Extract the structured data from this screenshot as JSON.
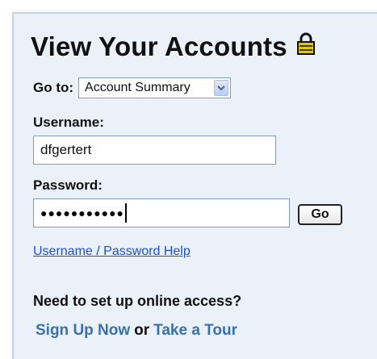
{
  "panel": {
    "title": "View Your Accounts"
  },
  "goto": {
    "label": "Go to:",
    "selected": "Account Summary"
  },
  "username": {
    "label": "Username:",
    "value": "dfgertert"
  },
  "password": {
    "label": "Password:",
    "masked_value": "●●●●●●●●●●●"
  },
  "go_button": {
    "label": "Go"
  },
  "help_link": {
    "label": "Username / Password Help"
  },
  "online_access": {
    "prompt": "Need to set up online access?",
    "signup_label": "Sign Up Now",
    "or_label": "or",
    "tour_label": "Take a Tour"
  },
  "colors": {
    "panel_background": "#eaf1f8",
    "panel_border": "#c2d4e6",
    "link_blue": "#1f4fd1",
    "action_link": "#3a71a8",
    "lock_gold": "#e3c800"
  },
  "icons": {
    "lock": "lock-icon",
    "dropdown": "chevron-down-icon"
  }
}
